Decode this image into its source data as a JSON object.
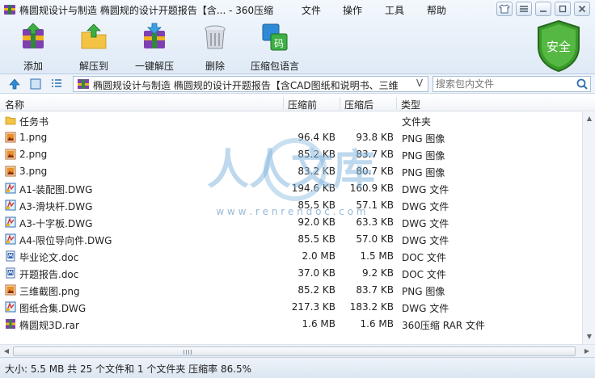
{
  "window": {
    "title": "椭圆规设计与制造 椭圆规的设计开题报告【含... - 360压缩",
    "menus": [
      "文件",
      "操作",
      "工具",
      "帮助"
    ]
  },
  "toolbar": {
    "add": "添加",
    "extract_to": "解压到",
    "one_click_extract": "一键解压",
    "delete": "删除",
    "encoding": "压缩包语言",
    "encoding_icon_text": "码"
  },
  "security": {
    "label": "安全",
    "color": "#3a9a2c"
  },
  "address": {
    "path": "椭圆规设计与制造 椭圆规的设计开题报告【含CAD图纸和说明书、三维",
    "dropdown": "V",
    "search_placeholder": "搜索包内文件"
  },
  "columns": {
    "name": "名称",
    "size": "压缩前",
    "packed": "压缩后",
    "type": "类型"
  },
  "files": [
    {
      "name": "任务书",
      "size": "",
      "packed": "",
      "type": "文件夹",
      "icon": "folder-icon"
    },
    {
      "name": "1.png",
      "size": "96.4 KB",
      "packed": "93.8 KB",
      "type": "PNG 图像",
      "icon": "image-file-icon"
    },
    {
      "name": "2.png",
      "size": "85.2 KB",
      "packed": "83.7 KB",
      "type": "PNG 图像",
      "icon": "image-file-icon"
    },
    {
      "name": "3.png",
      "size": "83.2 KB",
      "packed": "80.7 KB",
      "type": "PNG 图像",
      "icon": "image-file-icon"
    },
    {
      "name": "A1-装配图.DWG",
      "size": "194.6 KB",
      "packed": "160.9 KB",
      "type": "DWG 文件",
      "icon": "dwg-file-icon"
    },
    {
      "name": "A3-滑块杆.DWG",
      "size": "85.5 KB",
      "packed": "57.1 KB",
      "type": "DWG 文件",
      "icon": "dwg-file-icon"
    },
    {
      "name": "A3-十字板.DWG",
      "size": "92.0 KB",
      "packed": "63.3 KB",
      "type": "DWG 文件",
      "icon": "dwg-file-icon"
    },
    {
      "name": "A4-限位导向件.DWG",
      "size": "85.5 KB",
      "packed": "57.0 KB",
      "type": "DWG 文件",
      "icon": "dwg-file-icon"
    },
    {
      "name": "毕业论文.doc",
      "size": "2.0 MB",
      "packed": "1.5 MB",
      "type": "DOC 文件",
      "icon": "doc-file-icon"
    },
    {
      "name": "开题报告.doc",
      "size": "37.0 KB",
      "packed": "9.2 KB",
      "type": "DOC 文件",
      "icon": "doc-file-icon"
    },
    {
      "name": "三维截图.png",
      "size": "85.2 KB",
      "packed": "83.7 KB",
      "type": "PNG 图像",
      "icon": "image-file-icon"
    },
    {
      "name": "图纸合集.DWG",
      "size": "217.3 KB",
      "packed": "183.2 KB",
      "type": "DWG 文件",
      "icon": "dwg-file-icon"
    },
    {
      "name": "椭圆规3D.rar",
      "size": "1.6 MB",
      "packed": "1.6 MB",
      "type": "360压缩 RAR 文件",
      "icon": "rar-file-icon"
    }
  ],
  "watermark": {
    "text": "人人文库",
    "url": "w w w . r e n r e n d o c . c o m"
  },
  "status": "大小: 5.5 MB 共 25 个文件和 1 个文件夹 压缩率 86.5%"
}
